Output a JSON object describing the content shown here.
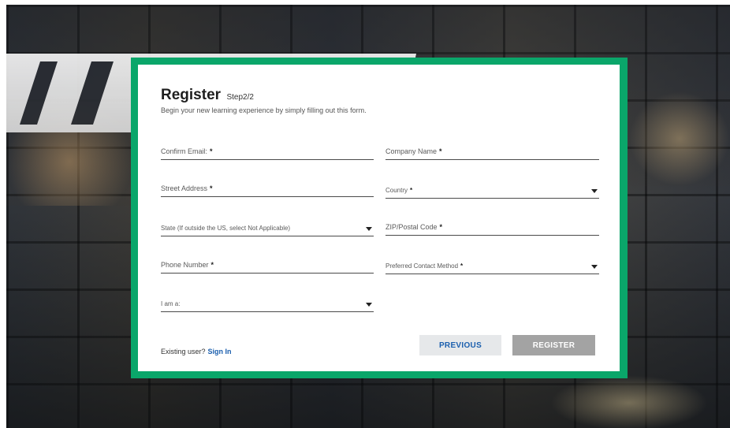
{
  "form": {
    "title": "Register",
    "step": "Step2/2",
    "subtitle": "Begin your new learning experience by simply filling out this form.",
    "required_mark": "*",
    "fields": {
      "confirm_email": "Confirm Email:",
      "company_name": "Company Name",
      "street_address": "Street Address",
      "country": "Country",
      "state": "State (If outside the US, select Not Applicable)",
      "zip": "ZIP/Postal Code",
      "phone": "Phone Number",
      "contact_method": "Preferred Contact Method",
      "i_am_a": "I am a:"
    },
    "existing_user": "Existing user?",
    "sign_in": "Sign In",
    "previous_label": "PREVIOUS",
    "register_label": "REGISTER"
  },
  "colors": {
    "frame": "#0aa66a",
    "link": "#1b5fae",
    "register_button": "#a3a3a3",
    "previous_button": "#e6e8ea"
  }
}
